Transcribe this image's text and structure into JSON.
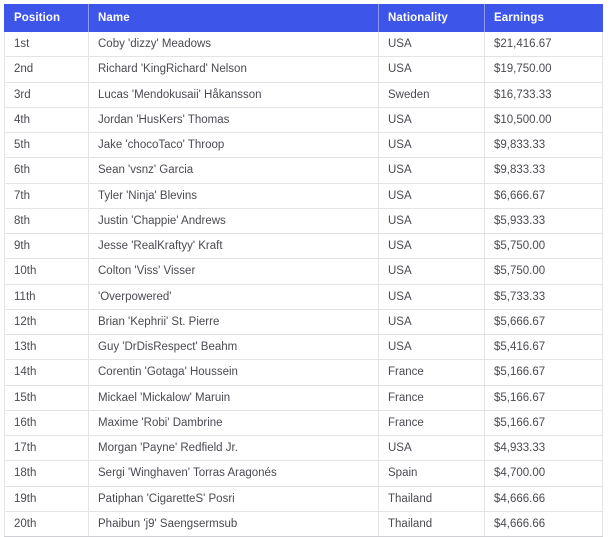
{
  "table": {
    "columns": [
      {
        "key": "position",
        "label": "Position"
      },
      {
        "key": "name",
        "label": "Name"
      },
      {
        "key": "nationality",
        "label": "Nationality"
      },
      {
        "key": "earnings",
        "label": "Earnings"
      }
    ],
    "header_background": "#3d55e8",
    "header_text_color": "#ffffff",
    "body_text_color": "#4a4a52",
    "row_border_color": "#e3e3e6",
    "rows": [
      {
        "position": "1st",
        "name": "Coby 'dizzy' Meadows",
        "nationality": "USA",
        "earnings": "$21,416.67"
      },
      {
        "position": "2nd",
        "name": "Richard 'KingRichard' Nelson",
        "nationality": "USA",
        "earnings": "$19,750.00"
      },
      {
        "position": "3rd",
        "name": "Lucas 'Mendokusaii' Håkansson",
        "nationality": "Sweden",
        "earnings": "$16,733.33"
      },
      {
        "position": "4th",
        "name": "Jordan 'HusKers' Thomas",
        "nationality": "USA",
        "earnings": "$10,500.00"
      },
      {
        "position": "5th",
        "name": "Jake 'chocoTaco' Throop",
        "nationality": "USA",
        "earnings": "$9,833.33"
      },
      {
        "position": "6th",
        "name": "Sean 'vsnz' Garcia",
        "nationality": "USA",
        "earnings": "$9,833.33"
      },
      {
        "position": "7th",
        "name": "Tyler 'Ninja' Blevins",
        "nationality": "USA",
        "earnings": "$6,666.67"
      },
      {
        "position": "8th",
        "name": "Justin 'Chappie' Andrews",
        "nationality": "USA",
        "earnings": "$5,933.33"
      },
      {
        "position": "9th",
        "name": "Jesse 'RealKraftyy' Kraft",
        "nationality": "USA",
        "earnings": "$5,750.00"
      },
      {
        "position": "10th",
        "name": "Colton 'Viss' Visser",
        "nationality": "USA",
        "earnings": "$5,750.00"
      },
      {
        "position": "11th",
        "name": "'Overpowered'",
        "nationality": "USA",
        "earnings": "$5,733.33"
      },
      {
        "position": "12th",
        "name": "Brian 'Kephrii' St. Pierre",
        "nationality": "USA",
        "earnings": "$5,666.67"
      },
      {
        "position": "13th",
        "name": "Guy 'DrDisRespect' Beahm",
        "nationality": "USA",
        "earnings": "$5,416.67"
      },
      {
        "position": "14th",
        "name": "Corentin 'Gotaga' Houssein",
        "nationality": "France",
        "earnings": "$5,166.67"
      },
      {
        "position": "15th",
        "name": "Mickael 'Mickalow' Maruin",
        "nationality": "France",
        "earnings": "$5,166.67"
      },
      {
        "position": "16th",
        "name": "Maxime 'Robi' Dambrine",
        "nationality": "France",
        "earnings": "$5,166.67"
      },
      {
        "position": "17th",
        "name": "Morgan 'Payne' Redfield Jr.",
        "nationality": "USA",
        "earnings": "$4,933.33"
      },
      {
        "position": "18th",
        "name": "Sergi 'Winghaven' Torras Aragonés",
        "nationality": "Spain",
        "earnings": "$4,700.00"
      },
      {
        "position": "19th",
        "name": "Patiphan 'CigaretteS' Posri",
        "nationality": "Thailand",
        "earnings": "$4,666.66"
      },
      {
        "position": "20th",
        "name": "Phaibun 'j9' Saengsermsub",
        "nationality": "Thailand",
        "earnings": "$4,666.66"
      }
    ]
  }
}
